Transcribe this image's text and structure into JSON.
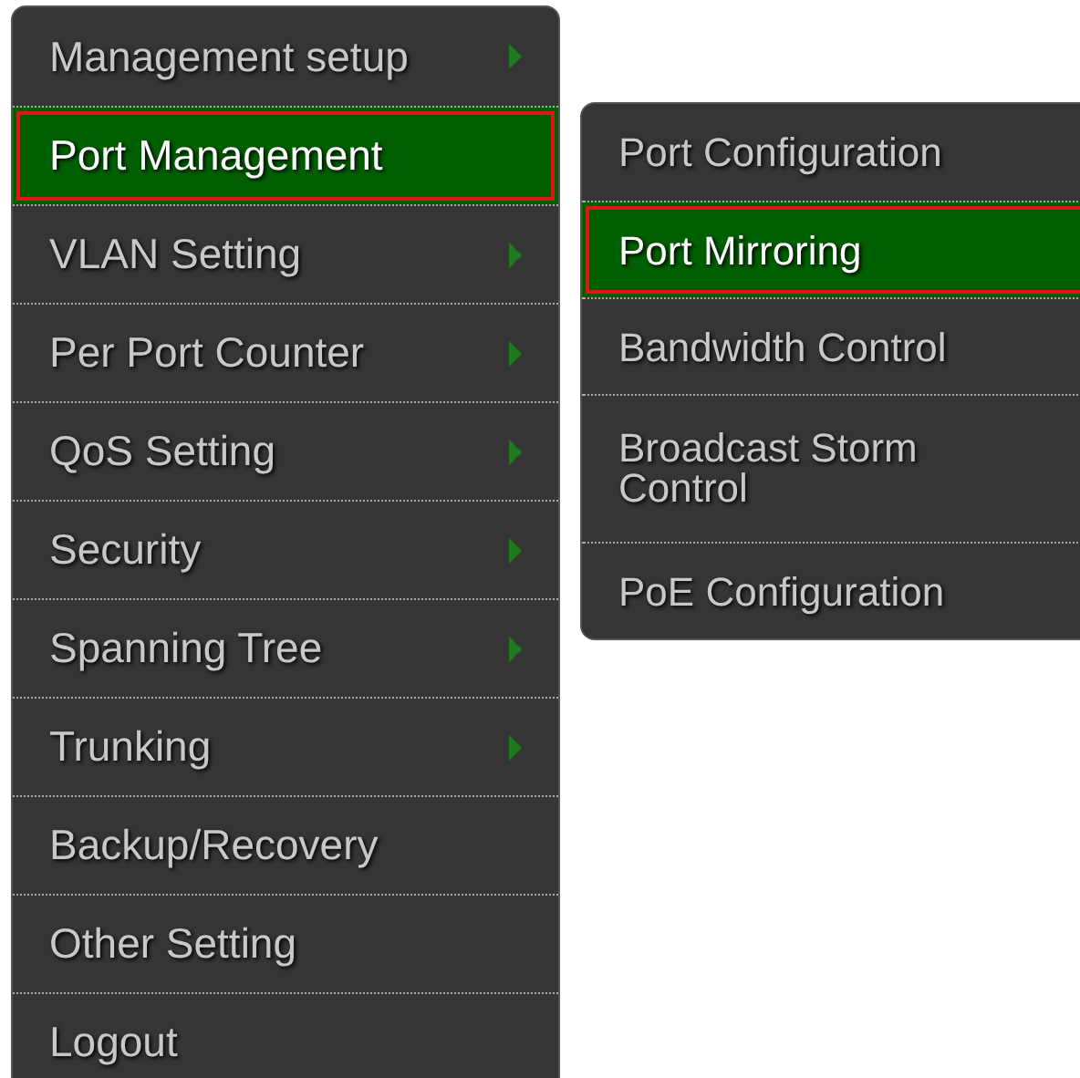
{
  "main_menu": [
    {
      "label": "Management setup",
      "selected": false,
      "has_submenu": true
    },
    {
      "label": "Port Management",
      "selected": true,
      "has_submenu": false
    },
    {
      "label": "VLAN Setting",
      "selected": false,
      "has_submenu": true
    },
    {
      "label": "Per Port Counter",
      "selected": false,
      "has_submenu": true
    },
    {
      "label": "QoS Setting",
      "selected": false,
      "has_submenu": true
    },
    {
      "label": "Security",
      "selected": false,
      "has_submenu": true
    },
    {
      "label": "Spanning Tree",
      "selected": false,
      "has_submenu": true
    },
    {
      "label": "Trunking",
      "selected": false,
      "has_submenu": true
    },
    {
      "label": "Backup/Recovery",
      "selected": false,
      "has_submenu": false
    },
    {
      "label": "Other Setting",
      "selected": false,
      "has_submenu": false
    },
    {
      "label": "Logout",
      "selected": false,
      "has_submenu": false
    }
  ],
  "submenu": [
    {
      "label": "Port Configuration",
      "selected": false
    },
    {
      "label": "Port Mirroring",
      "selected": true
    },
    {
      "label": "Bandwidth Control",
      "selected": false
    },
    {
      "label": "Broadcast Storm Control",
      "selected": false
    },
    {
      "label": "PoE Configuration",
      "selected": false
    }
  ]
}
